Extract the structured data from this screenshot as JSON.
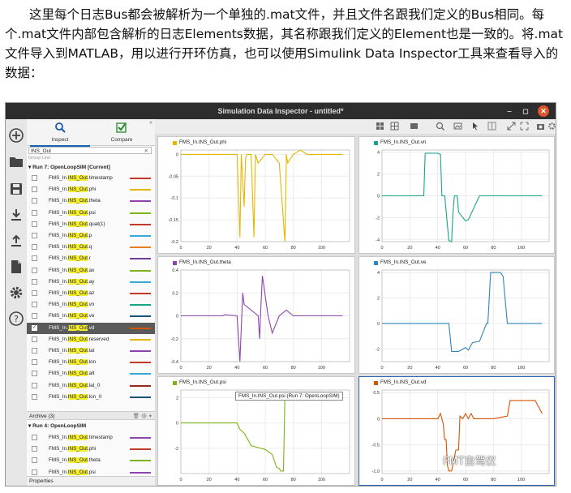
{
  "article": {
    "p1": "这里每个日志Bus都会被解析为一个单独的.mat文件，并且文件名跟我们定义的Bus相同。每个.mat文件内部包含解析的日志Elements数据，其名称跟我们定义的Element也是一致的。将.mat文件导入到MATLAB，用以进行开环仿真，也可以使用Simulink Data Inspector工具来查看导入的数据："
  },
  "window": {
    "title": "Simulation Data Inspector - untitled*"
  },
  "panel": {
    "tabs": [
      {
        "label": "Inspect",
        "icon": "magnifier-icon"
      },
      {
        "label": "Compare",
        "icon": "checkmark-icon"
      }
    ],
    "search_value": "INS_Out",
    "filter_hint": "Group          Line",
    "run7": "Run 7: OpenLoopSIM [Current]",
    "run7_signals": [
      {
        "pre": "FMS_In.",
        "hl": "INS_Out",
        "post": ".timestamp",
        "color": "#c0392b"
      },
      {
        "pre": "FMS_In.",
        "hl": "INS_Out",
        "post": ".phi",
        "color": "#e5b700"
      },
      {
        "pre": "FMS_In.",
        "hl": "INS_Out",
        "post": ".theta",
        "color": "#8e44ad"
      },
      {
        "pre": "FMS_In.",
        "hl": "INS_Out",
        "post": ".psi",
        "color": "#7cb518"
      },
      {
        "pre": "FMS_In.",
        "hl": "INS_Out",
        "post": ".quat(1)",
        "color": "#c0392b"
      },
      {
        "pre": "FMS_In.",
        "hl": "INS_Out",
        "post": ".p",
        "color": "#3aa7d8"
      },
      {
        "pre": "FMS_In.",
        "hl": "INS_Out",
        "post": ".q",
        "color": "#e67e22"
      },
      {
        "pre": "FMS_In.",
        "hl": "INS_Out",
        "post": ".r",
        "color": "#6f3c9a"
      },
      {
        "pre": "FMS_In.",
        "hl": "INS_Out",
        "post": ".ax",
        "color": "#7cb518"
      },
      {
        "pre": "FMS_In.",
        "hl": "INS_Out",
        "post": ".ay",
        "color": "#3aa7d8"
      },
      {
        "pre": "FMS_In.",
        "hl": "INS_Out",
        "post": ".az",
        "color": "#c0392b"
      },
      {
        "pre": "FMS_In.",
        "hl": "INS_Out",
        "post": ".vn",
        "color": "#17a589"
      },
      {
        "pre": "FMS_In.",
        "hl": "INS_Out",
        "post": ".ve",
        "color": "#1a5276"
      },
      {
        "pre": "FMS_In.",
        "hl": "INS_Out",
        "post": ".vd",
        "color": "#d35400"
      },
      {
        "pre": "FMS_In.",
        "hl": "INS_Out",
        "post": ".reserved",
        "color": "#e5b700"
      },
      {
        "pre": "FMS_In.",
        "hl": "INS_Out",
        "post": ".lat",
        "color": "#8e44ad"
      },
      {
        "pre": "FMS_In.",
        "hl": "INS_Out",
        "post": ".lon",
        "color": "#c0392b"
      },
      {
        "pre": "FMS_In.",
        "hl": "INS_Out",
        "post": ".alt",
        "color": "#3aa7d8"
      },
      {
        "pre": "FMS_In.",
        "hl": "INS_Out",
        "post": ".lat_0",
        "color": "#922b21"
      },
      {
        "pre": "FMS_In.",
        "hl": "INS_Out",
        "post": ".lon_0",
        "color": "#1a5276"
      }
    ],
    "archive": "Archive (3)",
    "run4": "Run 4: OpenLoopSIM",
    "run4_signals": [
      {
        "pre": "FMS_In.",
        "hl": "INS_Out",
        "post": ".timestamp",
        "color": "#8e44ad"
      },
      {
        "pre": "FMS_In.",
        "hl": "INS_Out",
        "post": ".phi",
        "color": "#c0392b"
      },
      {
        "pre": "FMS_In.",
        "hl": "INS_Out",
        "post": ".theta",
        "color": "#7cb518"
      },
      {
        "pre": "FMS_In.",
        "hl": "INS_Out",
        "post": ".psi",
        "color": "#8e44ad"
      }
    ],
    "properties": "Properties"
  },
  "plots": [
    {
      "title": "FMS_In.INS_Out.phi",
      "color": "#e5b700"
    },
    {
      "title": "FMS_In.INS_Out.vn",
      "color": "#17a589"
    },
    {
      "title": "FMS_In.INS_Out.theta",
      "color": "#8e44ad"
    },
    {
      "title": "FMS_In.INS_Out.ve",
      "color": "#2e86c1"
    },
    {
      "title": "FMS_In.INS_Out.psi",
      "color": "#7cb518"
    },
    {
      "title": "FMS_In.INS_Out.vd",
      "color": "#d35400"
    }
  ],
  "chart_data": [
    {
      "type": "line",
      "title": "FMS_In.INS_Out.phi",
      "xlim": [
        0,
        120
      ],
      "ylim": [
        -0.2,
        0.01
      ],
      "xticks": [
        "0",
        "20",
        "40",
        "60",
        "80",
        "100"
      ],
      "yticks": [
        "0",
        "-0.05",
        "-0.1",
        "-0.15",
        "-0.2"
      ],
      "x": [
        0,
        10,
        20,
        30,
        40,
        42,
        43,
        45,
        46,
        47,
        50,
        52,
        53,
        55,
        60,
        65,
        70,
        74,
        75,
        76,
        80,
        85,
        90,
        100,
        110,
        115
      ],
      "y": [
        0,
        0,
        0,
        0,
        0,
        -0.19,
        0,
        -0.12,
        -0.01,
        0,
        0,
        -0.19,
        0,
        -0.02,
        0,
        0,
        -0.02,
        -0.2,
        0,
        -0.02,
        0,
        0.01,
        0,
        0,
        0,
        0
      ]
    },
    {
      "type": "line",
      "title": "FMS_In.INS_Out.vn",
      "xlim": [
        0,
        120
      ],
      "ylim": [
        -4.2,
        4.2
      ],
      "xticks": [
        "0",
        "20",
        "40",
        "60",
        "80",
        "100"
      ],
      "yticks": [
        "4",
        "2",
        "0",
        "-2",
        "-4"
      ],
      "x": [
        0,
        10,
        20,
        28,
        30,
        31,
        40,
        42,
        43,
        45,
        48,
        50,
        51,
        52,
        54,
        55,
        60,
        62,
        70,
        80,
        90,
        100,
        110,
        115
      ],
      "y": [
        0,
        0,
        0,
        0,
        0,
        3.9,
        3.9,
        3.8,
        0,
        0,
        -4.1,
        -4.2,
        -1.5,
        0,
        0,
        -1.5,
        -2.3,
        -2.2,
        0,
        0,
        0,
        0,
        0,
        0
      ]
    },
    {
      "type": "line",
      "title": "FMS_In.INS_Out.theta",
      "xlim": [
        0,
        120
      ],
      "ylim": [
        -0.4,
        0.4
      ],
      "xticks": [
        "0",
        "20",
        "40",
        "60",
        "80",
        "100"
      ],
      "yticks": [
        "0.4",
        "0.2",
        "0",
        "-0.2",
        "-0.4"
      ],
      "x": [
        0,
        10,
        20,
        28,
        30,
        31,
        40,
        42,
        43,
        44,
        45,
        55,
        56,
        57,
        58,
        62,
        65,
        70,
        75,
        80,
        90,
        100,
        110,
        115
      ],
      "y": [
        0,
        0,
        0,
        0,
        0,
        0.01,
        0,
        -0.4,
        -0.1,
        0.2,
        0.1,
        0,
        -0.2,
        0.1,
        0.35,
        0,
        -0.15,
        0,
        0.05,
        0,
        0,
        0,
        0,
        0
      ]
    },
    {
      "type": "line",
      "title": "FMS_In.INS_Out.ve",
      "xlim": [
        0,
        120
      ],
      "ylim": [
        -3,
        4.2
      ],
      "xticks": [
        "0",
        "20",
        "40",
        "60",
        "80",
        "100"
      ],
      "yticks": [
        "4",
        "2",
        "0",
        "-2"
      ],
      "x": [
        0,
        10,
        20,
        30,
        40,
        48,
        50,
        52,
        55,
        60,
        62,
        65,
        70,
        75,
        76,
        78,
        85,
        87,
        90,
        95,
        100,
        110,
        115
      ],
      "y": [
        0,
        0,
        0,
        0,
        0,
        0,
        -2.2,
        -2.2,
        -2.2,
        -1.9,
        -2.1,
        -1.5,
        -1.4,
        0,
        0,
        4,
        4,
        3.7,
        0,
        0,
        0,
        0,
        0
      ]
    },
    {
      "type": "line",
      "title": "FMS_In.INS_Out.psi",
      "xlim": [
        0,
        120
      ],
      "ylim": [
        -4,
        2.6
      ],
      "xticks": [
        "0",
        "20",
        "40",
        "60",
        "80",
        "100"
      ],
      "yticks": [
        "2",
        "0",
        "-2"
      ],
      "x": [
        0,
        20,
        40,
        42,
        45,
        47,
        50,
        60,
        65,
        68,
        70,
        71,
        73,
        74,
        75,
        80,
        100,
        115
      ],
      "y": [
        0,
        0,
        0,
        -0.5,
        -0.8,
        -1.2,
        -1.8,
        -2.1,
        -2.5,
        -3.5,
        -3.6,
        -3.8,
        -3.8,
        2.2,
        2.2,
        2.2,
        2.2,
        2.2
      ]
    },
    {
      "type": "line",
      "title": "FMS_In.INS_Out.vd",
      "xlim": [
        0,
        120
      ],
      "ylim": [
        -1.05,
        0.55
      ],
      "xticks": [
        "0",
        "20",
        "40",
        "60",
        "80",
        "100"
      ],
      "yticks": [
        "0.5",
        "0",
        "-0.5",
        "-1.0"
      ],
      "x": [
        0,
        10,
        20,
        30,
        35,
        40,
        42,
        44,
        45,
        46,
        47,
        48,
        50,
        53,
        55,
        56,
        58,
        60,
        62,
        64,
        66,
        70,
        80,
        90,
        92,
        95,
        100,
        110,
        115
      ],
      "y": [
        0,
        0,
        0,
        0,
        0,
        0,
        0.1,
        -0.1,
        -0.4,
        -0.4,
        -0.9,
        -1.0,
        -1.0,
        -0.6,
        -0.6,
        0.05,
        0,
        0.1,
        0,
        0.1,
        0,
        0,
        0,
        0.05,
        0.35,
        0.35,
        0.35,
        0.35,
        0.1
      ]
    }
  ],
  "tooltip": "FMS_In.INS_Out.psi (Run 7: OpenLoopSIM)",
  "watermark": "FMT自驾仪"
}
